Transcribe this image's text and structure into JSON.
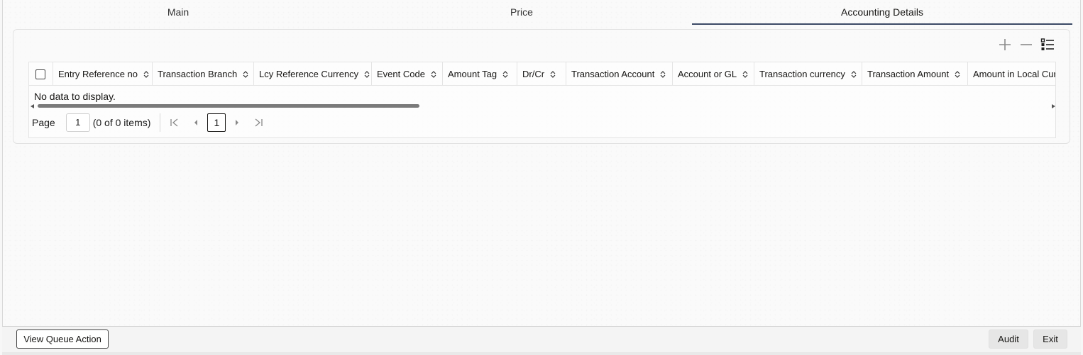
{
  "tabs": [
    {
      "label": "Main"
    },
    {
      "label": "Price"
    },
    {
      "label": "Accounting Details"
    }
  ],
  "active_tab": "Accounting Details",
  "toolbar": {
    "icons": [
      "add-icon",
      "remove-icon",
      "column-list-icon"
    ]
  },
  "grid": {
    "columns": [
      {
        "label": "Entry Reference no"
      },
      {
        "label": "Transaction Branch"
      },
      {
        "label": "Lcy Reference Currency"
      },
      {
        "label": "Event Code"
      },
      {
        "label": "Amount Tag"
      },
      {
        "label": "Dr/Cr"
      },
      {
        "label": "Transaction Account"
      },
      {
        "label": "Account or GL"
      },
      {
        "label": "Transaction currency"
      },
      {
        "label": "Transaction Amount"
      },
      {
        "label": "Amount in Local Curre"
      }
    ],
    "empty_message": "No data to display."
  },
  "pager": {
    "page_label": "Page",
    "page_value": "1",
    "items_text": "(0 of 0 items)",
    "current_page": "1"
  },
  "footer": {
    "view_queue_action": "View Queue Action",
    "audit": "Audit",
    "exit": "Exit"
  },
  "colors": {
    "active_tab_underline": "#3b4a66",
    "text": "#161513"
  }
}
